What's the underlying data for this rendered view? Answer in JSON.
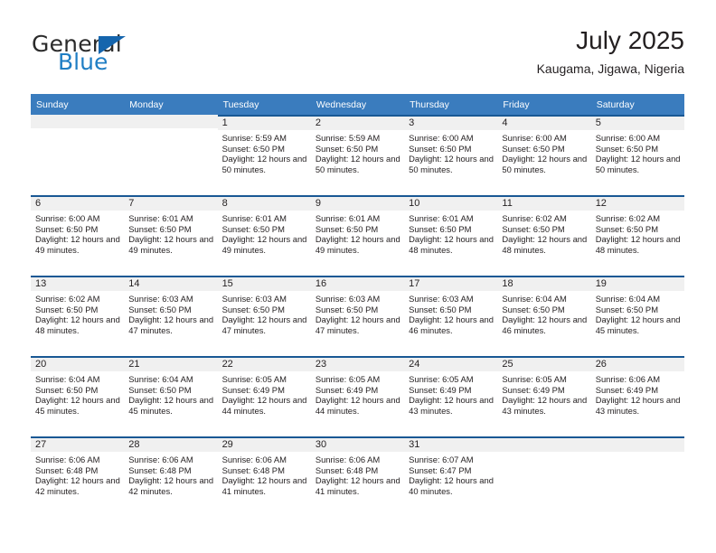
{
  "brand": {
    "name_part1": "General",
    "name_part2": "Blue"
  },
  "header": {
    "title": "July 2025",
    "subtitle": "Kaugama, Jigawa, Nigeria"
  },
  "calendar": {
    "weekday_headers": [
      "Sunday",
      "Monday",
      "Tuesday",
      "Wednesday",
      "Thursday",
      "Friday",
      "Saturday"
    ],
    "colors": {
      "header_background": "#3a7cbe",
      "row_rule": "#195894",
      "daynum_band": "#f0f0f0",
      "brand_blue": "#1f7ec4",
      "text": "#231f20"
    },
    "weeks": [
      [
        {
          "day": "",
          "sunrise": "",
          "sunset": "",
          "daylight": "",
          "empty": true
        },
        {
          "day": "",
          "sunrise": "",
          "sunset": "",
          "daylight": "",
          "empty": true
        },
        {
          "day": "1",
          "sunrise": "Sunrise: 5:59 AM",
          "sunset": "Sunset: 6:50 PM",
          "daylight": "Daylight: 12 hours and 50 minutes."
        },
        {
          "day": "2",
          "sunrise": "Sunrise: 5:59 AM",
          "sunset": "Sunset: 6:50 PM",
          "daylight": "Daylight: 12 hours and 50 minutes."
        },
        {
          "day": "3",
          "sunrise": "Sunrise: 6:00 AM",
          "sunset": "Sunset: 6:50 PM",
          "daylight": "Daylight: 12 hours and 50 minutes."
        },
        {
          "day": "4",
          "sunrise": "Sunrise: 6:00 AM",
          "sunset": "Sunset: 6:50 PM",
          "daylight": "Daylight: 12 hours and 50 minutes."
        },
        {
          "day": "5",
          "sunrise": "Sunrise: 6:00 AM",
          "sunset": "Sunset: 6:50 PM",
          "daylight": "Daylight: 12 hours and 50 minutes."
        }
      ],
      [
        {
          "day": "6",
          "sunrise": "Sunrise: 6:00 AM",
          "sunset": "Sunset: 6:50 PM",
          "daylight": "Daylight: 12 hours and 49 minutes."
        },
        {
          "day": "7",
          "sunrise": "Sunrise: 6:01 AM",
          "sunset": "Sunset: 6:50 PM",
          "daylight": "Daylight: 12 hours and 49 minutes."
        },
        {
          "day": "8",
          "sunrise": "Sunrise: 6:01 AM",
          "sunset": "Sunset: 6:50 PM",
          "daylight": "Daylight: 12 hours and 49 minutes."
        },
        {
          "day": "9",
          "sunrise": "Sunrise: 6:01 AM",
          "sunset": "Sunset: 6:50 PM",
          "daylight": "Daylight: 12 hours and 49 minutes."
        },
        {
          "day": "10",
          "sunrise": "Sunrise: 6:01 AM",
          "sunset": "Sunset: 6:50 PM",
          "daylight": "Daylight: 12 hours and 48 minutes."
        },
        {
          "day": "11",
          "sunrise": "Sunrise: 6:02 AM",
          "sunset": "Sunset: 6:50 PM",
          "daylight": "Daylight: 12 hours and 48 minutes."
        },
        {
          "day": "12",
          "sunrise": "Sunrise: 6:02 AM",
          "sunset": "Sunset: 6:50 PM",
          "daylight": "Daylight: 12 hours and 48 minutes."
        }
      ],
      [
        {
          "day": "13",
          "sunrise": "Sunrise: 6:02 AM",
          "sunset": "Sunset: 6:50 PM",
          "daylight": "Daylight: 12 hours and 48 minutes."
        },
        {
          "day": "14",
          "sunrise": "Sunrise: 6:03 AM",
          "sunset": "Sunset: 6:50 PM",
          "daylight": "Daylight: 12 hours and 47 minutes."
        },
        {
          "day": "15",
          "sunrise": "Sunrise: 6:03 AM",
          "sunset": "Sunset: 6:50 PM",
          "daylight": "Daylight: 12 hours and 47 minutes."
        },
        {
          "day": "16",
          "sunrise": "Sunrise: 6:03 AM",
          "sunset": "Sunset: 6:50 PM",
          "daylight": "Daylight: 12 hours and 47 minutes."
        },
        {
          "day": "17",
          "sunrise": "Sunrise: 6:03 AM",
          "sunset": "Sunset: 6:50 PM",
          "daylight": "Daylight: 12 hours and 46 minutes."
        },
        {
          "day": "18",
          "sunrise": "Sunrise: 6:04 AM",
          "sunset": "Sunset: 6:50 PM",
          "daylight": "Daylight: 12 hours and 46 minutes."
        },
        {
          "day": "19",
          "sunrise": "Sunrise: 6:04 AM",
          "sunset": "Sunset: 6:50 PM",
          "daylight": "Daylight: 12 hours and 45 minutes."
        }
      ],
      [
        {
          "day": "20",
          "sunrise": "Sunrise: 6:04 AM",
          "sunset": "Sunset: 6:50 PM",
          "daylight": "Daylight: 12 hours and 45 minutes."
        },
        {
          "day": "21",
          "sunrise": "Sunrise: 6:04 AM",
          "sunset": "Sunset: 6:50 PM",
          "daylight": "Daylight: 12 hours and 45 minutes."
        },
        {
          "day": "22",
          "sunrise": "Sunrise: 6:05 AM",
          "sunset": "Sunset: 6:49 PM",
          "daylight": "Daylight: 12 hours and 44 minutes."
        },
        {
          "day": "23",
          "sunrise": "Sunrise: 6:05 AM",
          "sunset": "Sunset: 6:49 PM",
          "daylight": "Daylight: 12 hours and 44 minutes."
        },
        {
          "day": "24",
          "sunrise": "Sunrise: 6:05 AM",
          "sunset": "Sunset: 6:49 PM",
          "daylight": "Daylight: 12 hours and 43 minutes."
        },
        {
          "day": "25",
          "sunrise": "Sunrise: 6:05 AM",
          "sunset": "Sunset: 6:49 PM",
          "daylight": "Daylight: 12 hours and 43 minutes."
        },
        {
          "day": "26",
          "sunrise": "Sunrise: 6:06 AM",
          "sunset": "Sunset: 6:49 PM",
          "daylight": "Daylight: 12 hours and 43 minutes."
        }
      ],
      [
        {
          "day": "27",
          "sunrise": "Sunrise: 6:06 AM",
          "sunset": "Sunset: 6:48 PM",
          "daylight": "Daylight: 12 hours and 42 minutes."
        },
        {
          "day": "28",
          "sunrise": "Sunrise: 6:06 AM",
          "sunset": "Sunset: 6:48 PM",
          "daylight": "Daylight: 12 hours and 42 minutes."
        },
        {
          "day": "29",
          "sunrise": "Sunrise: 6:06 AM",
          "sunset": "Sunset: 6:48 PM",
          "daylight": "Daylight: 12 hours and 41 minutes."
        },
        {
          "day": "30",
          "sunrise": "Sunrise: 6:06 AM",
          "sunset": "Sunset: 6:48 PM",
          "daylight": "Daylight: 12 hours and 41 minutes."
        },
        {
          "day": "31",
          "sunrise": "Sunrise: 6:07 AM",
          "sunset": "Sunset: 6:47 PM",
          "daylight": "Daylight: 12 hours and 40 minutes."
        },
        {
          "day": "",
          "sunrise": "",
          "sunset": "",
          "daylight": "",
          "empty": true
        },
        {
          "day": "",
          "sunrise": "",
          "sunset": "",
          "daylight": "",
          "empty": true
        }
      ]
    ]
  }
}
